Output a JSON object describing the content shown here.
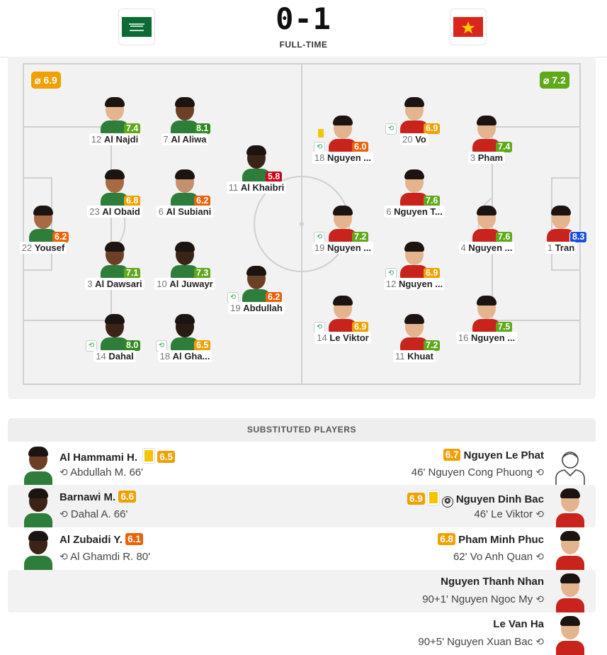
{
  "match": {
    "score": "0-1",
    "status": "FULL-TIME",
    "home_flag": "saudi-arabia-flag",
    "away_flag": "vietnam-flag"
  },
  "team_ratings": {
    "home": "6.9",
    "away": "7.2"
  },
  "colors": {
    "orange": "#f0a000",
    "green": "#5fa81a",
    "dark_orange": "#e8630a",
    "red": "#d0021b",
    "blue": "#1a4fe0"
  },
  "home_players": [
    {
      "num": "12",
      "name": "Al Najdi",
      "rating": "7.4",
      "rc": "green"
    },
    {
      "num": "7",
      "name": "Al Aliwa",
      "rating": "8.1",
      "rc": "dkgreen"
    },
    {
      "num": "11",
      "name": "Al Khaibri",
      "rating": "5.8",
      "rc": "red"
    },
    {
      "num": "23",
      "name": "Al Obaid",
      "rating": "6.8",
      "rc": "orange"
    },
    {
      "num": "6",
      "name": "Al Subiani",
      "rating": "6.2",
      "rc": "dkorange"
    },
    {
      "num": "22",
      "name": "Yousef",
      "rating": "6.2",
      "rc": "dkorange"
    },
    {
      "num": "3",
      "name": "Al Dawsari",
      "rating": "7.1",
      "rc": "green"
    },
    {
      "num": "10",
      "name": "Al Juwayr",
      "rating": "7.3",
      "rc": "green"
    },
    {
      "num": "19",
      "name": "Abdullah",
      "rating": "6.2",
      "rc": "dkorange"
    },
    {
      "num": "14",
      "name": "Dahal",
      "rating": "8.0",
      "rc": "dkgreen"
    },
    {
      "num": "18",
      "name": "Al Gha...",
      "rating": "6.5",
      "rc": "orange"
    }
  ],
  "away_players": [
    {
      "num": "20",
      "name": "Vo",
      "rating": "6.9",
      "rc": "orange"
    },
    {
      "num": "18",
      "name": "Nguyen ...",
      "rating": "6.0",
      "rc": "dkorange"
    },
    {
      "num": "3",
      "name": "Pham",
      "rating": "7.4",
      "rc": "green"
    },
    {
      "num": "6",
      "name": "Nguyen T...",
      "rating": "7.6",
      "rc": "green"
    },
    {
      "num": "19",
      "name": "Nguyen ...",
      "rating": "7.2",
      "rc": "green"
    },
    {
      "num": "4",
      "name": "Nguyen ...",
      "rating": "7.6",
      "rc": "green"
    },
    {
      "num": "1",
      "name": "Tran",
      "rating": "8.3",
      "rc": "blue"
    },
    {
      "num": "12",
      "name": "Nguyen ...",
      "rating": "6.9",
      "rc": "orange"
    },
    {
      "num": "14",
      "name": "Le Viktor",
      "rating": "6.9",
      "rc": "orange"
    },
    {
      "num": "16",
      "name": "Nguyen ...",
      "rating": "7.5",
      "rc": "green"
    },
    {
      "num": "11",
      "name": "Khuat",
      "rating": "7.2",
      "rc": "green"
    }
  ],
  "subs_header": "SUBSTITUTED PLAYERS",
  "subs": [
    {
      "home_name": "Al Hammami H.",
      "home_rating": "6.5",
      "home_detail": "Abdullah M. 66'",
      "away_name": "Nguyen Le Phat",
      "away_rating": "6.7",
      "away_detail": "46'  Nguyen Cong Phuong"
    },
    {
      "home_name": "Barnawi M.",
      "home_rating": "6.6",
      "home_detail": "Dahal A. 66'",
      "away_name": "Nguyen Dinh Bac",
      "away_rating": "6.9",
      "away_detail": "46'  Le Viktor"
    },
    {
      "home_name": "Al Zubaidi Y.",
      "home_rating": "6.1",
      "home_detail": "Al Ghamdi R. 80'",
      "away_name": "Pham Minh Phuc",
      "away_rating": "6.8",
      "away_detail": "62'  Vo Anh Quan"
    },
    {
      "away_name": "Nguyen Thanh Nhan",
      "away_detail": "90+1'  Nguyen Ngoc My"
    },
    {
      "away_name": "Le Van Ha",
      "away_detail": "90+5'  Nguyen Xuan Bac"
    }
  ]
}
